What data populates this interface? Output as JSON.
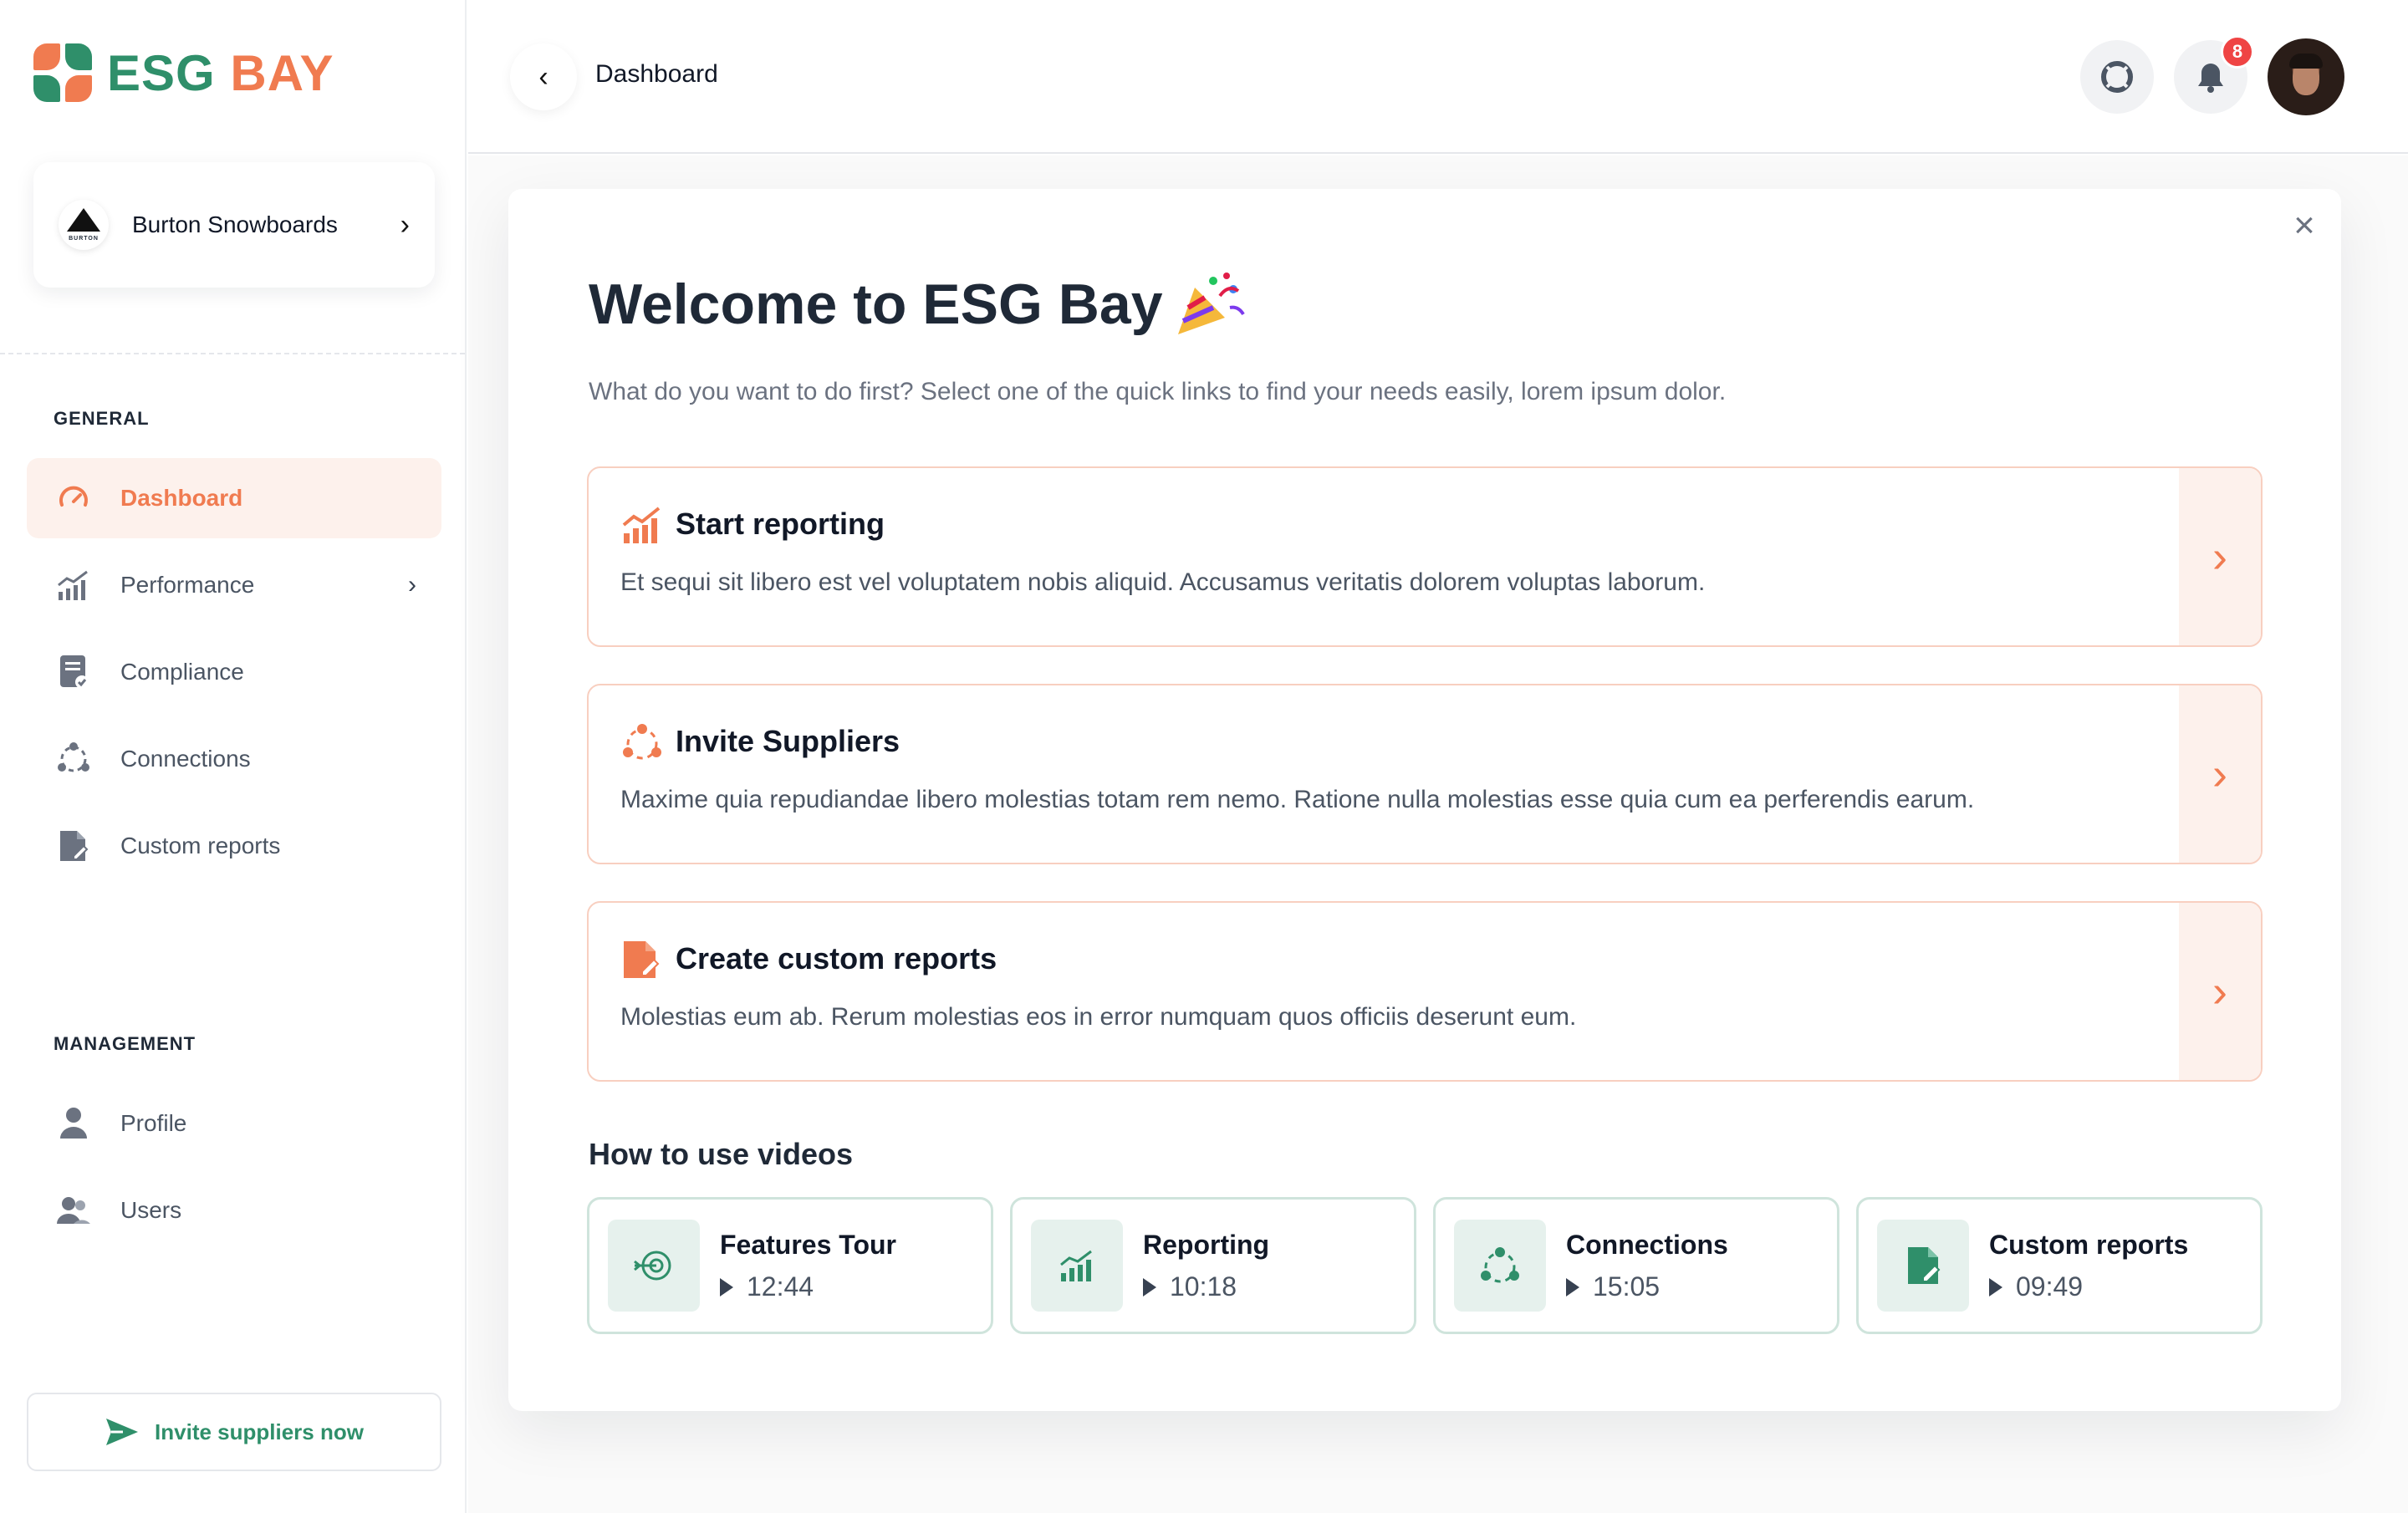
{
  "brand": {
    "part1": "ESG",
    "part2": "BAY",
    "green": "#2f8f6a",
    "orange": "#f07b50"
  },
  "organization": {
    "name": "Burton Snowboards",
    "logo_text": "BURTON"
  },
  "sidebar": {
    "general_label": "GENERAL",
    "general_items": [
      {
        "label": "Dashboard",
        "icon": "speedometer-icon",
        "active": true
      },
      {
        "label": "Performance",
        "icon": "chart-icon",
        "has_submenu": true
      },
      {
        "label": "Compliance",
        "icon": "clipboard-check-icon"
      },
      {
        "label": "Connections",
        "icon": "connections-icon"
      },
      {
        "label": "Custom reports",
        "icon": "document-edit-icon"
      }
    ],
    "management_label": "MANAGEMENT",
    "management_items": [
      {
        "label": "Profile",
        "icon": "user-icon"
      },
      {
        "label": "Users",
        "icon": "users-icon"
      }
    ],
    "invite_button": "Invite suppliers now"
  },
  "header": {
    "title": "Dashboard",
    "notification_count": "8"
  },
  "welcome": {
    "title": "Welcome to ESG Bay",
    "subtitle": "What do you want to do first? Select one of the quick links to find your needs easily, lorem ipsum dolor."
  },
  "quick_links": [
    {
      "title": "Start reporting",
      "description": "Et sequi sit libero est vel voluptatem nobis aliquid. Accusamus veritatis dolorem voluptas laborum.",
      "icon": "chart-icon"
    },
    {
      "title": "Invite Suppliers",
      "description": "Maxime quia repudiandae libero molestias totam rem nemo. Ratione nulla molestias esse quia cum ea perferendis earum.",
      "icon": "connections-icon"
    },
    {
      "title": "Create custom reports",
      "description": "Molestias eum ab. Rerum molestias eos in error numquam quos officiis deserunt eum.",
      "icon": "document-edit-icon"
    }
  ],
  "videos_title": "How to use videos",
  "videos": [
    {
      "title": "Features Tour",
      "duration": "12:44",
      "icon": "target-arrow-icon"
    },
    {
      "title": "Reporting",
      "duration": "10:18",
      "icon": "chart-icon"
    },
    {
      "title": "Connections",
      "duration": "15:05",
      "icon": "connections-icon"
    },
    {
      "title": "Custom reports",
      "duration": "09:49",
      "icon": "document-edit-icon"
    }
  ]
}
